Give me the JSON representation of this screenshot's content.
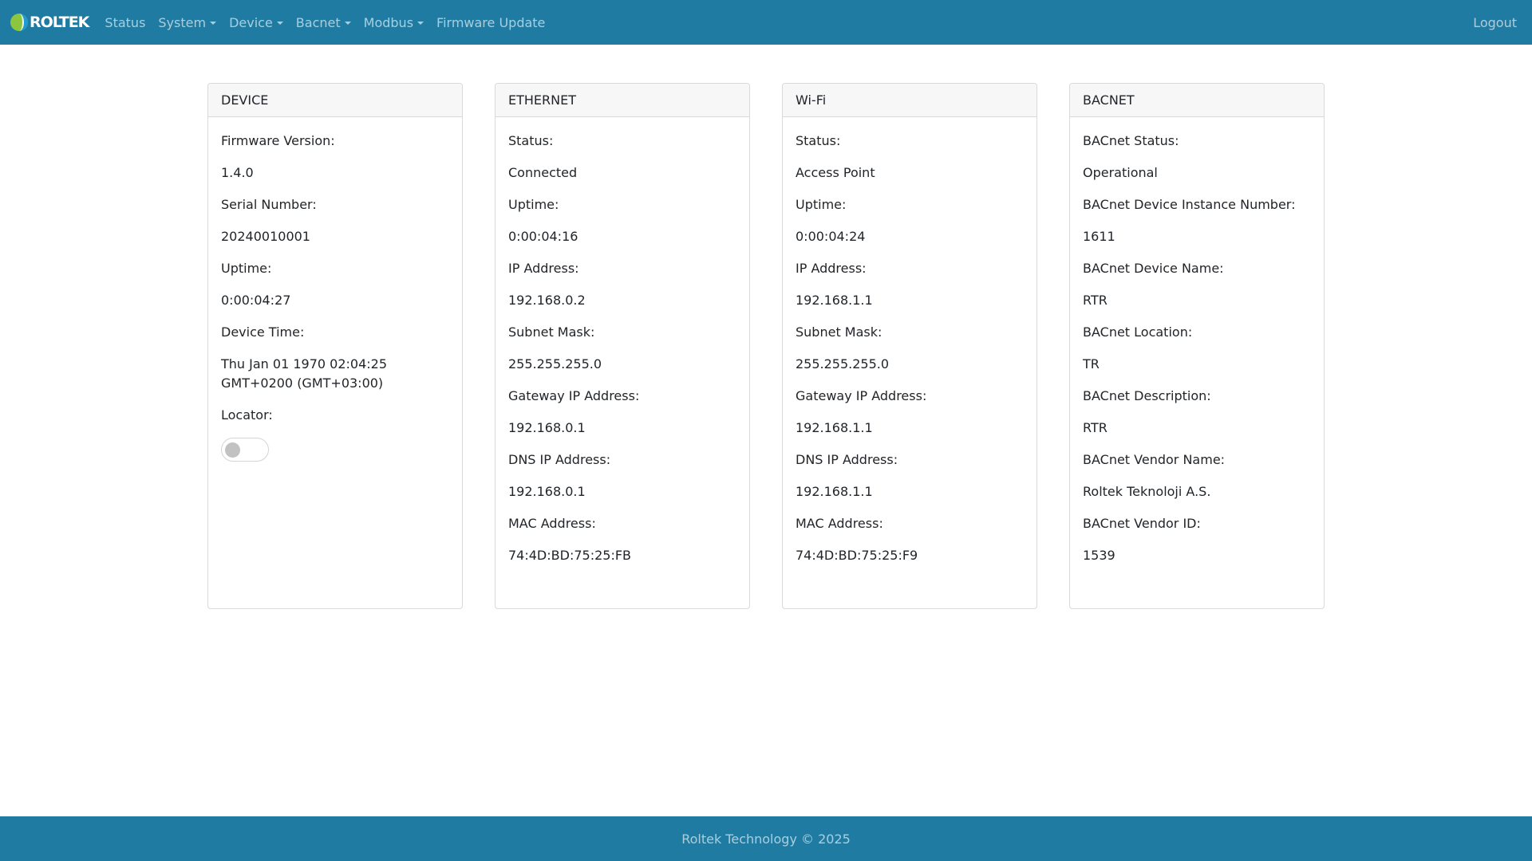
{
  "brand": {
    "name": "ROLTEK",
    "logo_icon": "roltek-logo-icon"
  },
  "nav": {
    "items": [
      {
        "label": "Status",
        "dropdown": false
      },
      {
        "label": "System",
        "dropdown": true
      },
      {
        "label": "Device",
        "dropdown": true
      },
      {
        "label": "Bacnet",
        "dropdown": true
      },
      {
        "label": "Modbus",
        "dropdown": true
      },
      {
        "label": "Firmware Update",
        "dropdown": false
      }
    ],
    "logout_label": "Logout"
  },
  "cards": {
    "device": {
      "title": "DEVICE",
      "firmware_label": "Firmware Version:",
      "firmware_value": "1.4.0",
      "serial_label": "Serial Number:",
      "serial_value": "20240010001",
      "uptime_label": "Uptime:",
      "uptime_value": "0:00:04:27",
      "time_label": "Device Time:",
      "time_value": "Thu Jan 01 1970 02:04:25 GMT+0200 (GMT+03:00)",
      "locator_label": "Locator:",
      "locator_on": false
    },
    "ethernet": {
      "title": "ETHERNET",
      "status_label": "Status:",
      "status_value": "Connected",
      "uptime_label": "Uptime:",
      "uptime_value": "0:00:04:16",
      "ip_label": "IP Address:",
      "ip_value": "192.168.0.2",
      "subnet_label": "Subnet Mask:",
      "subnet_value": "255.255.255.0",
      "gateway_label": "Gateway IP Address:",
      "gateway_value": "192.168.0.1",
      "dns_label": "DNS IP Address:",
      "dns_value": "192.168.0.1",
      "mac_label": "MAC Address:",
      "mac_value": "74:4D:BD:75:25:FB"
    },
    "wifi": {
      "title": "Wi-Fi",
      "status_label": "Status:",
      "status_value": "Access Point",
      "uptime_label": "Uptime:",
      "uptime_value": "0:00:04:24",
      "ip_label": "IP Address:",
      "ip_value": "192.168.1.1",
      "subnet_label": "Subnet Mask:",
      "subnet_value": "255.255.255.0",
      "gateway_label": "Gateway IP Address:",
      "gateway_value": "192.168.1.1",
      "dns_label": "DNS IP Address:",
      "dns_value": "192.168.1.1",
      "mac_label": "MAC Address:",
      "mac_value": "74:4D:BD:75:25:F9"
    },
    "bacnet": {
      "title": "BACNET",
      "status_label": "BACnet Status:",
      "status_value": "Operational",
      "instance_label": "BACnet Device Instance Number:",
      "instance_value": "1611",
      "name_label": "BACnet Device Name:",
      "name_value": "RTR",
      "location_label": "BACnet Location:",
      "location_value": "TR",
      "description_label": "BACnet Description:",
      "description_value": "RTR",
      "vendor_name_label": "BACnet Vendor Name:",
      "vendor_name_value": "Roltek Teknoloji A.S.",
      "vendor_id_label": "BACnet Vendor ID:",
      "vendor_id_value": "1539"
    }
  },
  "footer": {
    "text": "Roltek Technology © 2025"
  },
  "colors": {
    "primary": "#207ba2",
    "card_header": "#f7f7f7",
    "border": "#d9d9d9"
  }
}
